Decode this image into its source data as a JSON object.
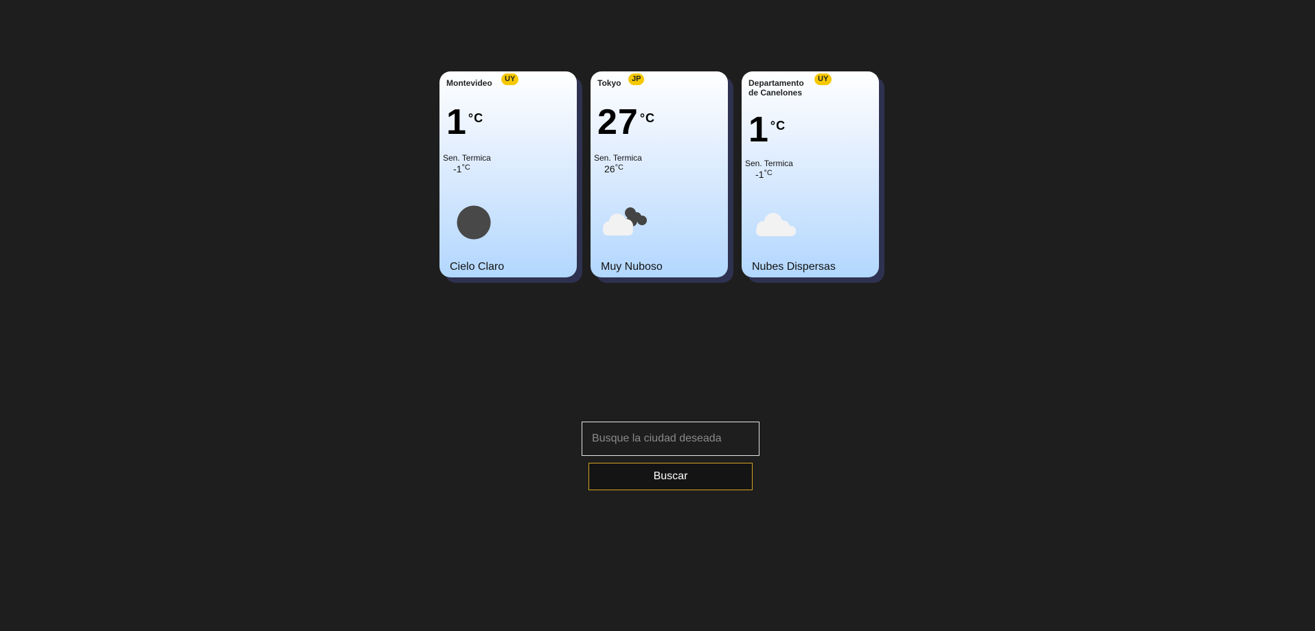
{
  "cards": [
    {
      "city": "Montevideo",
      "country": "UY",
      "temp": "1",
      "temp_unit": "°C",
      "feels_label": "Sen. Termica",
      "feels_value": "-1",
      "feels_unit": "°C",
      "icon": "clear-sky-moon-icon",
      "description": "Cielo Claro"
    },
    {
      "city": "Tokyo",
      "country": "JP",
      "temp": "27",
      "temp_unit": "°C",
      "feels_label": "Sen. Termica",
      "feels_value": "26",
      "feels_unit": "°C",
      "icon": "overcast-clouds-icon",
      "description": "Muy Nuboso"
    },
    {
      "city": "Departamento de Canelones",
      "country": "UY",
      "temp": "1",
      "temp_unit": "°C",
      "feels_label": "Sen. Termica",
      "feels_value": "-1",
      "feels_unit": "°C",
      "icon": "scattered-clouds-icon",
      "description": "Nubes Dispersas"
    }
  ],
  "search": {
    "placeholder": "Busque la ciudad deseada",
    "value": "",
    "button_label": "Buscar"
  },
  "colors": {
    "background": "#1e1e1e",
    "badge": "#f5c800",
    "card_shadow": "#2f3150",
    "button_border": "#d4a520"
  }
}
